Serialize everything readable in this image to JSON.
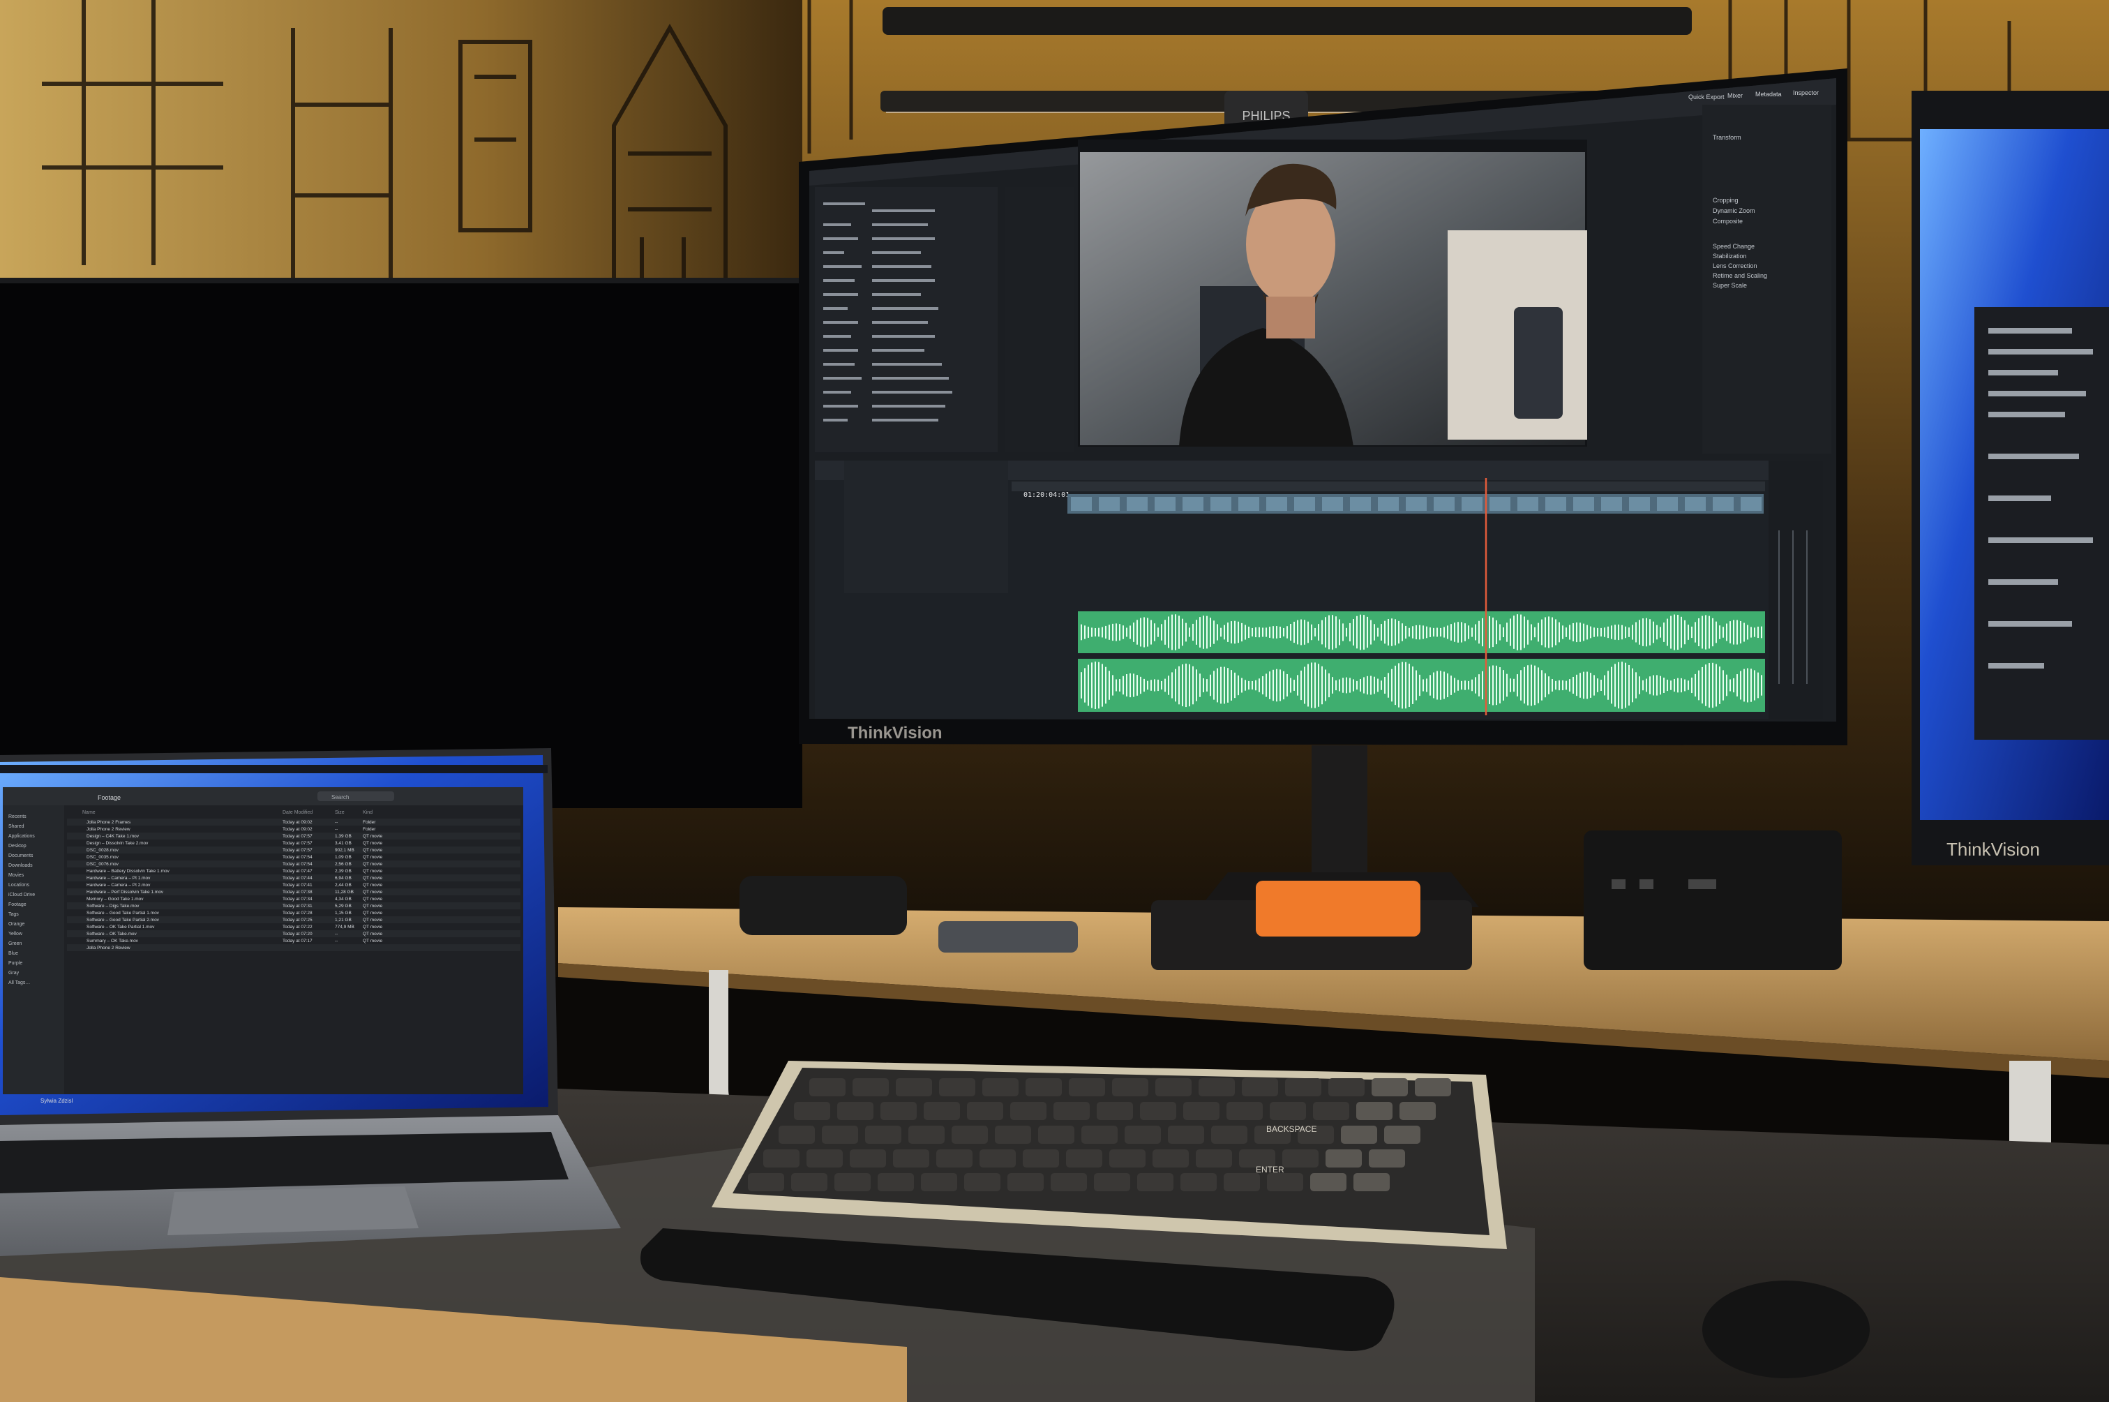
{
  "monitor_main": {
    "brand": "ThinkVision",
    "webcam_brand": "PHILIPS",
    "editor": {
      "timecode": "01:20:04:01",
      "inspector_tabs": [
        "Quick Export",
        "Mixer",
        "Metadata",
        "Inspector"
      ],
      "inspector_sections": [
        "Transform",
        "Cropping",
        "Dynamic Zoom",
        "Composite",
        "Speed Change",
        "Stabilization",
        "Lens Correction",
        "Retime and Scaling",
        "Super Scale"
      ]
    }
  },
  "monitor_right": {
    "brand": "ThinkVision"
  },
  "laptop": {
    "finder": {
      "window_title": "Footage",
      "search_placeholder": "Search",
      "columns": [
        "Name",
        "Date Modified",
        "Size",
        "Kind"
      ],
      "sidebar": [
        "Recents",
        "Shared",
        "Applications",
        "Desktop",
        "Documents",
        "Downloads",
        "Movies",
        "Locations",
        "iCloud Drive",
        "Footage",
        "Tags",
        "Orange",
        "Yellow",
        "Green",
        "Blue",
        "Purple",
        "Gray",
        "All Tags…"
      ],
      "rows": [
        {
          "name": "Jolla Phone 2 Frames",
          "date": "Today at 09:02",
          "size": "--",
          "kind": "Folder"
        },
        {
          "name": "Jolla Phone 2 Review",
          "date": "Today at 09:02",
          "size": "--",
          "kind": "Folder"
        },
        {
          "name": "Design – C4K Take 1.mov",
          "date": "Today at 07:57",
          "size": "1,39 GB",
          "kind": "QT movie"
        },
        {
          "name": "Design – Dissolvin Take 2.mov",
          "date": "Today at 07:57",
          "size": "3,41 GB",
          "kind": "QT movie"
        },
        {
          "name": "DSC_0028.mov",
          "date": "Today at 07:57",
          "size": "902,1 MB",
          "kind": "QT movie"
        },
        {
          "name": "DSC_0035.mov",
          "date": "Today at 07:54",
          "size": "1,09 GB",
          "kind": "QT movie"
        },
        {
          "name": "DSC_0076.mov",
          "date": "Today at 07:54",
          "size": "2,56 GB",
          "kind": "QT movie"
        },
        {
          "name": "Hardware – Battery Dissolvin Take 1.mov",
          "date": "Today at 07:47",
          "size": "2,39 GB",
          "kind": "QT movie"
        },
        {
          "name": "Hardware – Camera – Pt 1.mov",
          "date": "Today at 07:44",
          "size": "6,94 GB",
          "kind": "QT movie"
        },
        {
          "name": "Hardware – Camera – Pt 2.mov",
          "date": "Today at 07:41",
          "size": "2,44 GB",
          "kind": "QT movie"
        },
        {
          "name": "Hardware – Perf Dissolvin Take 1.mov",
          "date": "Today at 07:38",
          "size": "11,28 GB",
          "kind": "QT movie"
        },
        {
          "name": "Memory – Good Take 1.mov",
          "date": "Today at 07:34",
          "size": "4,34 GB",
          "kind": "QT movie"
        },
        {
          "name": "Software – Digs Take.mov",
          "date": "Today at 07:31",
          "size": "5,29 GB",
          "kind": "QT movie"
        },
        {
          "name": "Software – Good Take Partial 1.mov",
          "date": "Today at 07:28",
          "size": "1,15 GB",
          "kind": "QT movie"
        },
        {
          "name": "Software – Good Take Partial 2.mov",
          "date": "Today at 07:25",
          "size": "1,21 GB",
          "kind": "QT movie"
        },
        {
          "name": "Software – OK Take Partial 1.mov",
          "date": "Today at 07:22",
          "size": "774,9 MB",
          "kind": "QT movie"
        },
        {
          "name": "Software – OK Take.mov",
          "date": "Today at 07:20",
          "size": "--",
          "kind": "QT movie"
        },
        {
          "name": "Summary – OK Take.mov",
          "date": "Today at 07:17",
          "size": "--",
          "kind": "QT movie"
        },
        {
          "name": "Jolla Phone 2 Review",
          "date": "",
          "size": "",
          "kind": ""
        }
      ],
      "dock_user": "Sylwia Zdzisl"
    }
  },
  "keyboard": {
    "legends": [
      "BACKSPACE",
      "ENTER"
    ]
  },
  "colors": {
    "timeline_audio": "#3fae6f",
    "timeline_bg": "#1d2126",
    "playhead": "#e25b3a",
    "wallpaper_blue": "#1f4fd0",
    "orange_drive": "#f07a2a",
    "desk_wood": "#c69c63"
  }
}
